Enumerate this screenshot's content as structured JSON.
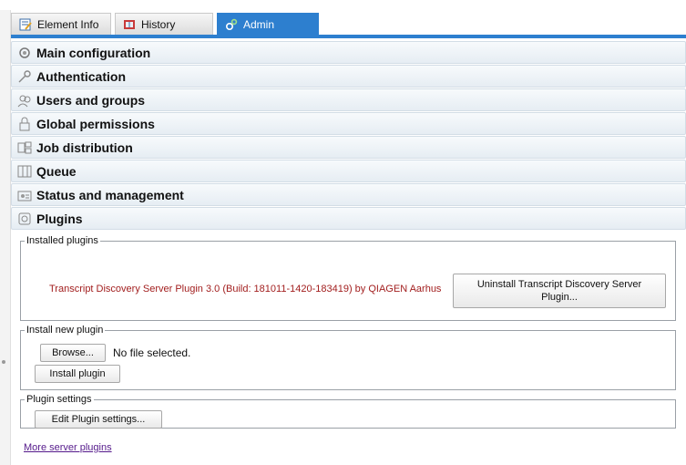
{
  "tabs": [
    {
      "label": "Element Info",
      "icon": "element-info-icon",
      "active": false
    },
    {
      "label": "History",
      "icon": "history-icon",
      "active": false
    },
    {
      "label": "Admin",
      "icon": "admin-gear-icon",
      "active": true
    }
  ],
  "sections": [
    {
      "label": "Main configuration",
      "icon": "main-config-icon"
    },
    {
      "label": "Authentication",
      "icon": "key-icon"
    },
    {
      "label": "Users and groups",
      "icon": "users-icon"
    },
    {
      "label": "Global permissions",
      "icon": "lock-icon"
    },
    {
      "label": "Job distribution",
      "icon": "job-distribution-icon"
    },
    {
      "label": "Queue",
      "icon": "queue-icon"
    },
    {
      "label": "Status and management",
      "icon": "status-icon"
    },
    {
      "label": "Plugins",
      "icon": "plugin-icon"
    }
  ],
  "plugins": {
    "installed": {
      "legend": "Installed plugins",
      "plugin_text": "Transcript Discovery Server Plugin 3.0 (Build: 181011-1420-183419) by QIAGEN Aarhus",
      "uninstall_label_line1": "Uninstall Transcript Discovery Server",
      "uninstall_label_line2": "Plugin..."
    },
    "install_new": {
      "legend": "Install new plugin",
      "browse_label": "Browse...",
      "file_status": "No file selected.",
      "install_label": "Install plugin"
    },
    "settings": {
      "legend": "Plugin settings",
      "edit_label": "Edit Plugin settings..."
    },
    "more_link": "More server plugins"
  },
  "colors": {
    "accent": "#2d7fcf",
    "plugin_text": "#a21e1e",
    "link": "#551a8b"
  }
}
